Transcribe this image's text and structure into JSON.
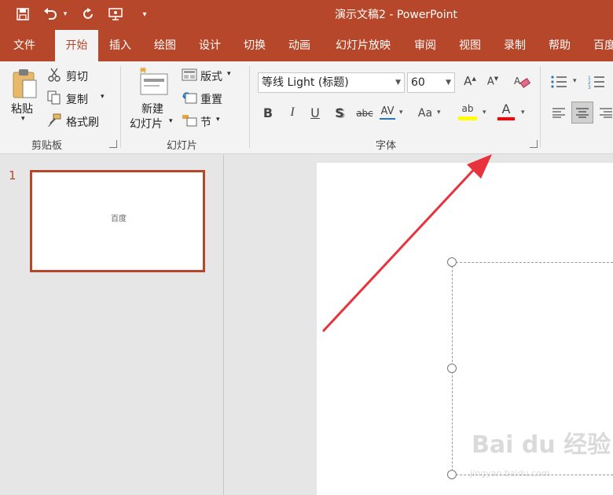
{
  "window": {
    "title": "演示文稿2  -  PowerPoint"
  },
  "tabs": [
    "文件",
    "开始",
    "插入",
    "绘图",
    "设计",
    "切换",
    "动画",
    "幻灯片放映",
    "审阅",
    "视图",
    "录制",
    "帮助",
    "百度"
  ],
  "active_tab": "开始",
  "clipboard": {
    "paste_label": "粘贴",
    "cut_label": "剪切",
    "copy_label": "复制",
    "format_painter_label": "格式刷",
    "group_label": "剪贴板"
  },
  "slides_group": {
    "new_slide_line1": "新建",
    "new_slide_line2": "幻灯片",
    "layout_label": "版式",
    "reset_label": "重置",
    "section_label": "节",
    "group_label": "幻灯片"
  },
  "font_group": {
    "font_name": "等线 Light (标题)",
    "font_size": "60",
    "group_label": "字体",
    "bold": "B",
    "italic": "I",
    "underline": "U",
    "shadow": "S",
    "strikethrough": "abc",
    "spacing": "AV",
    "case": "Aa",
    "highlight": "ab",
    "font_color": "A",
    "grow": "A",
    "shrink": "A"
  },
  "slide_panel": {
    "slide_number": "1",
    "thumb_text": "百度"
  },
  "watermark": {
    "text": "Bai du 经验",
    "sub": "jingyan.baidu.com"
  },
  "colors": {
    "accent": "#b7472a",
    "arrow": "#e8323c",
    "highlight_yellow": "#ffff00",
    "font_red": "#ff0000"
  }
}
